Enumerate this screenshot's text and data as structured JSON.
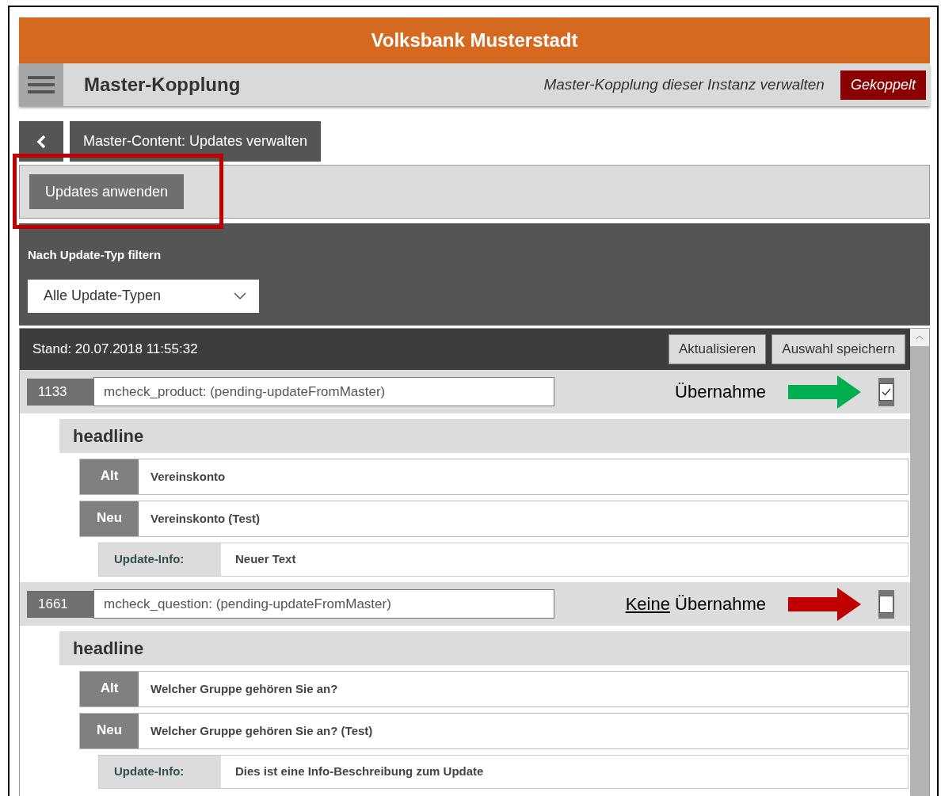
{
  "header": {
    "title": "Volksbank Musterstadt"
  },
  "toolbar": {
    "title": "Master-Kopplung",
    "subtitle": "Master-Kopplung dieser Instanz verwalten",
    "status": "Gekoppelt"
  },
  "page_title": "Master-Content: Updates verwalten",
  "actions": {
    "button": "Updates anwenden",
    "highlighted": true
  },
  "filter": {
    "label": "Nach Update-Typ filtern",
    "select": "Alle Update-Typen"
  },
  "list": {
    "stand": "Stand: 20.07.2018 11:55:32",
    "buttons": [
      "Aktualisieren",
      "Auswahl speichern"
    ],
    "items": [
      {
        "id": "1133",
        "name": "mcheck_product: (pending-updateFromMaster)",
        "checked": true,
        "annotation": {
          "text": "Übernahme",
          "color": "#00b050"
        },
        "field": "headline",
        "old_label": "Alt",
        "old": "Vereinskonto",
        "new_label": "Neu",
        "new": "Vereinskonto (Test)",
        "info_label": "Update-Info:",
        "info": "Neuer Text"
      },
      {
        "id": "1661",
        "name": "mcheck_question: (pending-updateFromMaster)",
        "checked": false,
        "annotation": {
          "emphasis": "Keine",
          "text": "Übernahme",
          "color": "#c00000"
        },
        "field": "headline",
        "old_label": "Alt",
        "old": "Welcher Gruppe gehören Sie an?",
        "new_label": "Neu",
        "new": "Welcher Gruppe gehören Sie an? (Test)",
        "info_label": "Update-Info:",
        "info": "Dies ist eine Info-Beschreibung zum Update"
      }
    ]
  }
}
